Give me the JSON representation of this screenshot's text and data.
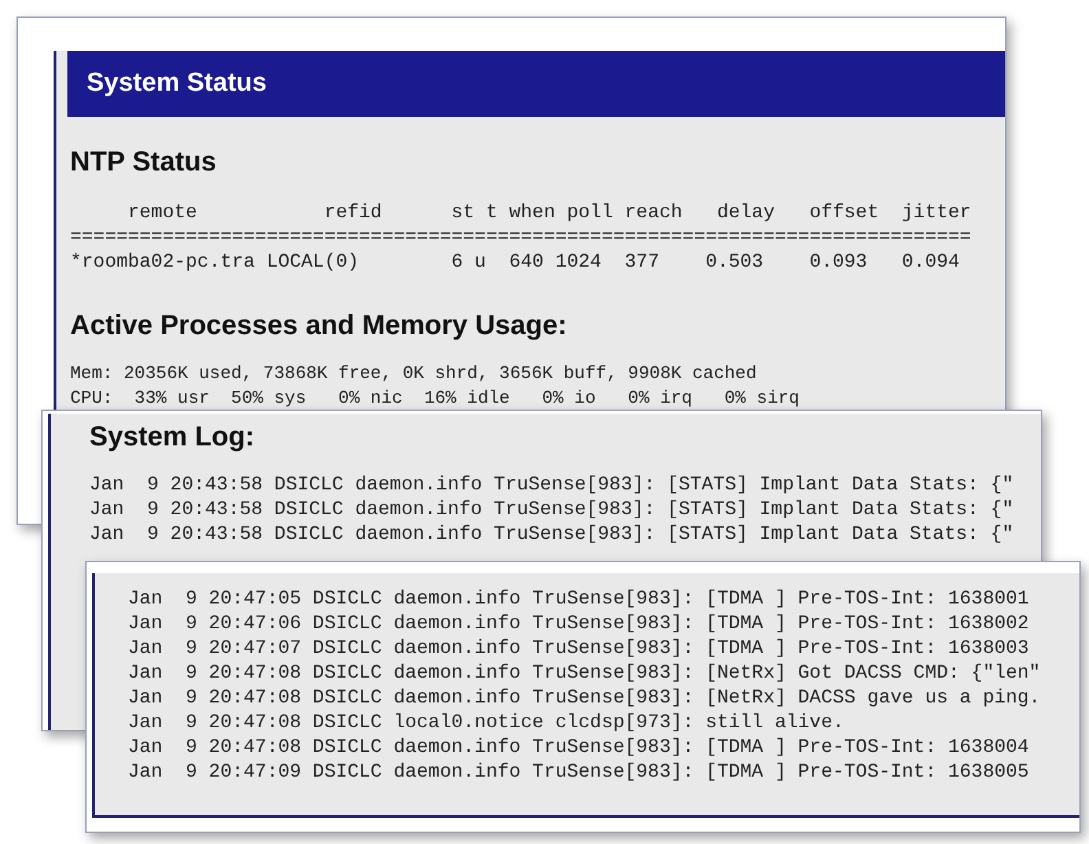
{
  "system_status": {
    "title": "System Status",
    "ntp": {
      "heading": "NTP Status",
      "header": "     remote           refid      st t when poll reach   delay   offset  jitter",
      "separator": "==============================================================================",
      "rows": [
        "*roomba02-pc.tra LOCAL(0)        6 u  640 1024  377    0.503    0.093   0.094"
      ]
    },
    "processes": {
      "heading": "Active Processes and Memory Usage:",
      "lines": [
        "Mem: 20356K used, 73868K free, 0K shrd, 3656K buff, 9908K cached",
        "CPU:  33% usr  50% sys   0% nic  16% idle   0% io   0% irq   0% sirq"
      ]
    }
  },
  "system_log": {
    "heading": "System Log:",
    "lines": [
      "Jan  9 20:43:58 DSICLC daemon.info TruSense[983]: [STATS] Implant Data Stats: {\"",
      "Jan  9 20:43:58 DSICLC daemon.info TruSense[983]: [STATS] Implant Data Stats: {\"",
      "Jan  9 20:43:58 DSICLC daemon.info TruSense[983]: [STATS] Implant Data Stats: {\""
    ]
  },
  "log_detail": {
    "lines": [
      "Jan  9 20:47:05 DSICLC daemon.info TruSense[983]: [TDMA ] Pre-TOS-Int: 1638001",
      "Jan  9 20:47:06 DSICLC daemon.info TruSense[983]: [TDMA ] Pre-TOS-Int: 1638002",
      "Jan  9 20:47:07 DSICLC daemon.info TruSense[983]: [TDMA ] Pre-TOS-Int: 1638003",
      "Jan  9 20:47:08 DSICLC daemon.info TruSense[983]: [NetRx] Got DACSS CMD: {\"len\"",
      "Jan  9 20:47:08 DSICLC daemon.info TruSense[983]: [NetRx] DACSS gave us a ping.",
      "Jan  9 20:47:08 DSICLC local0.notice clcdsp[973]: still alive.",
      "Jan  9 20:47:08 DSICLC daemon.info TruSense[983]: [TDMA ] Pre-TOS-Int: 1638004",
      "Jan  9 20:47:09 DSICLC daemon.info TruSense[983]: [TDMA ] Pre-TOS-Int: 1638005"
    ]
  }
}
